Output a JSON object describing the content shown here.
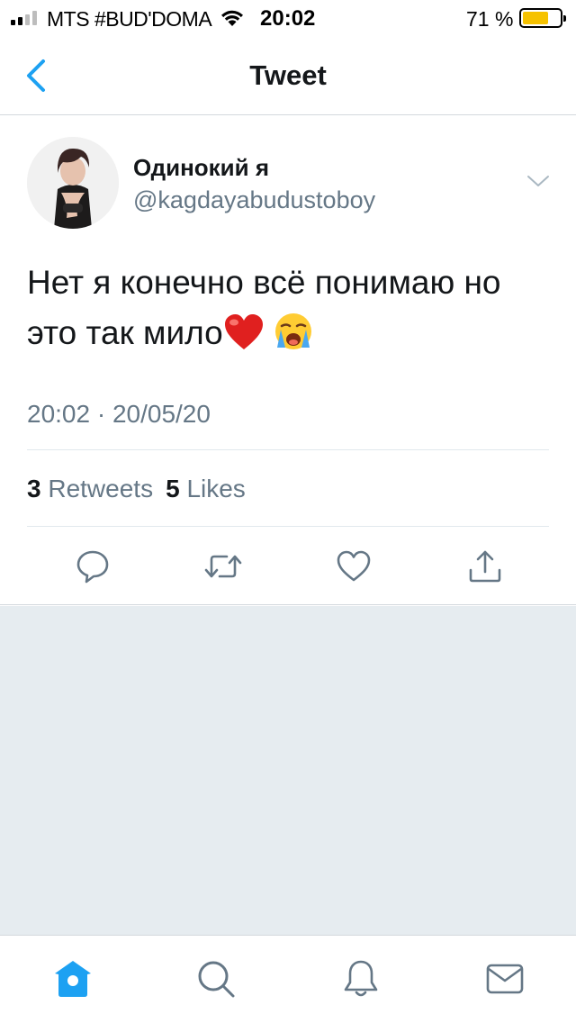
{
  "status_bar": {
    "carrier": "MTS #BUD'DOMA",
    "time": "20:02",
    "battery_percent": "71 %",
    "battery_level": 0.71
  },
  "nav": {
    "title": "Tweet"
  },
  "tweet": {
    "author_name": "Одинокий я",
    "author_handle": "@kagdayabudustoboy",
    "text_line1": "Нет я конечно всё понимаю но",
    "text_line2": "это так мило",
    "timestamp": "20:02 · 20/05/20",
    "retweets_count": "3",
    "retweets_label": "Retweets",
    "likes_count": "5",
    "likes_label": "Likes"
  },
  "colors": {
    "accent": "#1da1f2",
    "secondary_text": "#657786",
    "background_gray": "#e6ecf0",
    "battery": "#f6c200"
  },
  "icons": {
    "reply": "reply-icon",
    "retweet": "retweet-icon",
    "like": "heart-icon",
    "share": "share-icon",
    "home": "home-icon",
    "search": "search-icon",
    "notifications": "bell-icon",
    "messages": "mail-icon"
  }
}
